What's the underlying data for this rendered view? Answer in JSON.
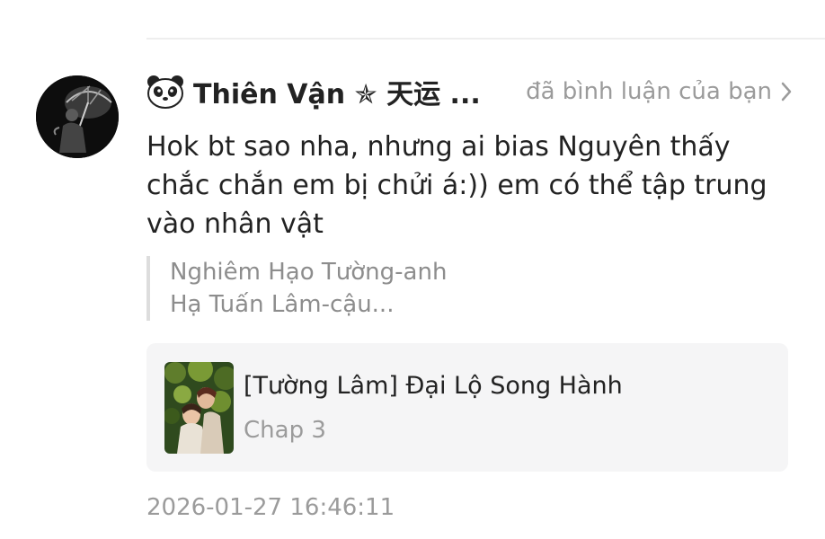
{
  "notification": {
    "user": {
      "name": "Thiên Vận ✯ 天运 ...",
      "badge_icon": "panda-icon",
      "avatar_icon": "umbrella-silhouette-avatar"
    },
    "action_text": "đã bình luận của bạn",
    "comment": "Hok bt sao nha, nhưng ai bias Nguyên thấy chắc chắn em bị chửi á:)) em có thể tập trung vào nhân vật",
    "quoted_lines": [
      "Nghiêm Hạo Tường-anh",
      "Hạ Tuấn Lâm-cậu..."
    ],
    "story": {
      "title": "[Tường Lâm] Đại Lộ Song Hành",
      "chapter": "Chap 3",
      "cover_icon": "story-cover-image"
    },
    "timestamp": "2026-01-27 16:46:11"
  },
  "colors": {
    "text_primary": "#222222",
    "text_secondary": "#9b9b9b",
    "card_bg": "#f5f5f6",
    "quote_bar": "#dddddd"
  }
}
